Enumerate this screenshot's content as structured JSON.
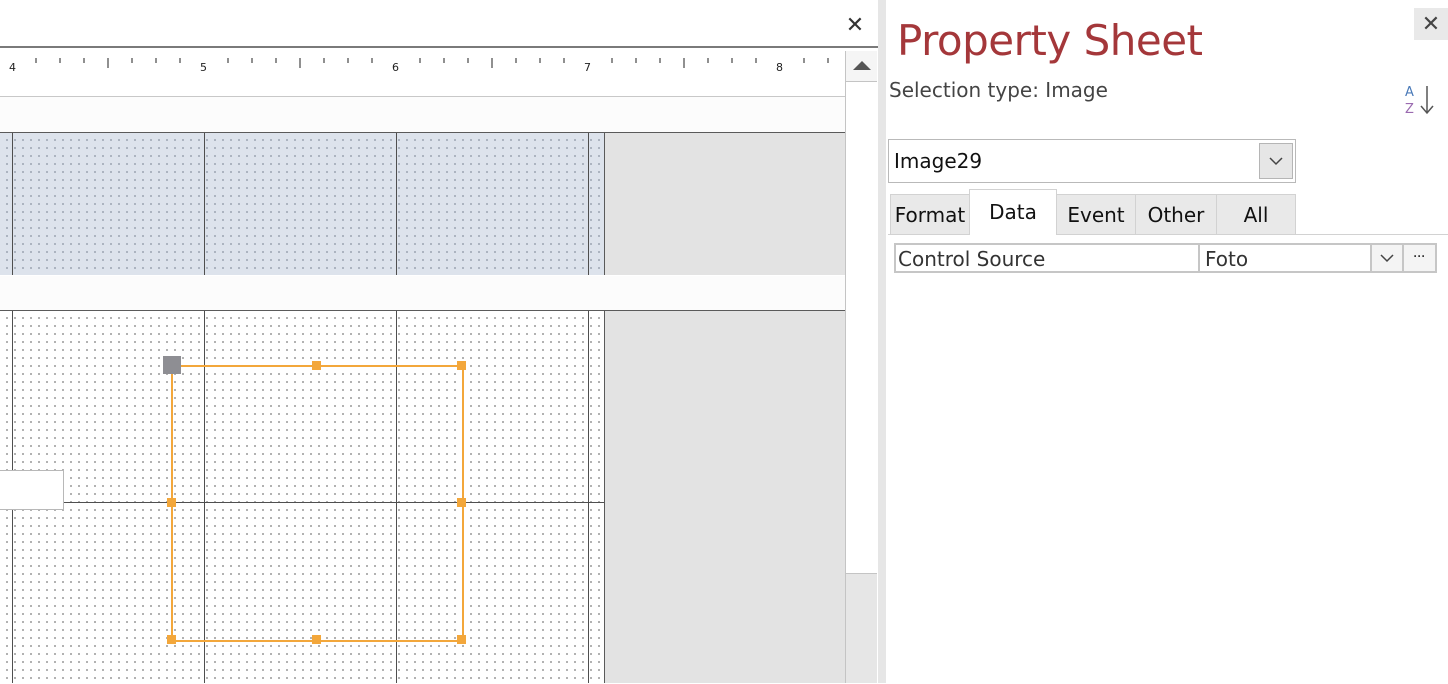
{
  "designer": {
    "close_glyph": "✕",
    "ruler_numbers": [
      "4",
      "5",
      "6",
      "7",
      "8"
    ]
  },
  "property_sheet": {
    "title": "Property Sheet",
    "close_glyph": "✕",
    "selection_type": "Selection type: Image",
    "sort_icon": "sort-az-icon",
    "selected_object": "Image29",
    "tabs": [
      {
        "label": "Format",
        "active": false
      },
      {
        "label": "Data",
        "active": true
      },
      {
        "label": "Event",
        "active": false
      },
      {
        "label": "Other",
        "active": false
      },
      {
        "label": "All",
        "active": false
      }
    ],
    "properties": [
      {
        "name": "Control Source",
        "value": "Foto",
        "build_glyph": "···"
      }
    ]
  },
  "colors": {
    "title": "#a4373a",
    "selection_border": "#f3a73b",
    "move_handle": "#8e8e93",
    "header_grid": "#dde3ec"
  }
}
